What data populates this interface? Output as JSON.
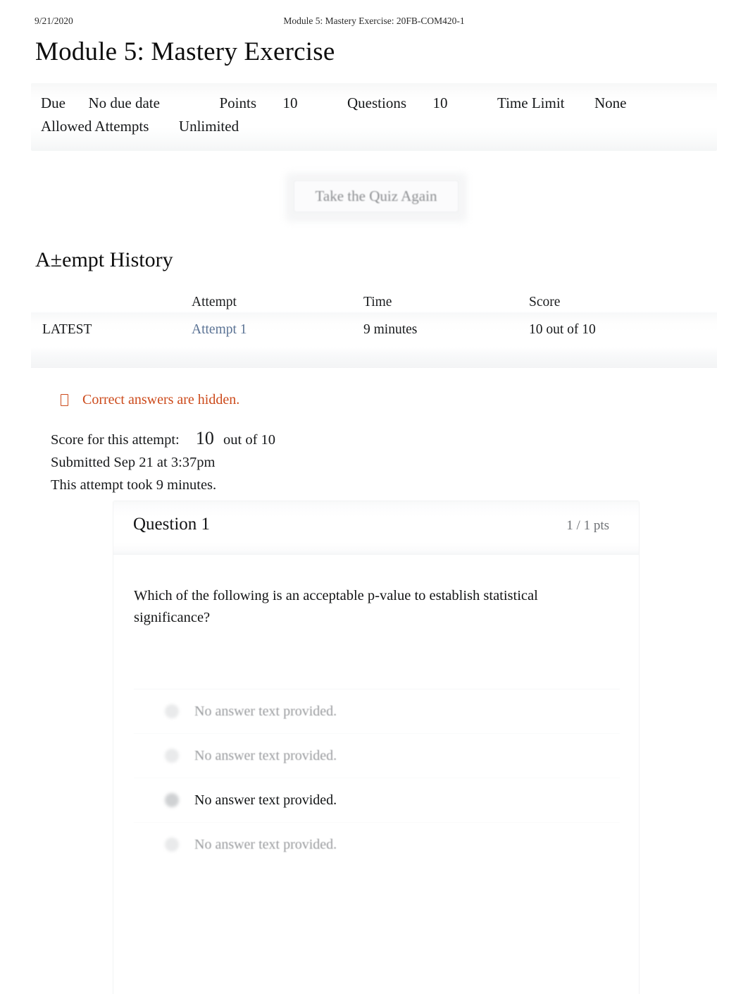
{
  "print_header": {
    "date": "9/21/2020",
    "title": "Module 5: Mastery Exercise: 20FB-COM420-1"
  },
  "page_title": "Module 5: Mastery Exercise",
  "quiz_meta": {
    "due_label": "Due",
    "due_value": "No due date",
    "points_label": "Points",
    "points_value": "10",
    "questions_label": "Questions",
    "questions_value": "10",
    "time_limit_label": "Time Limit",
    "time_limit_value": "None",
    "attempts_label": "Allowed Attempts",
    "attempts_value": "Unlimited"
  },
  "retake_button": {
    "label": "Take the Quiz Again"
  },
  "attempt_history": {
    "section_title": "A±empt History",
    "columns": [
      "",
      "Attempt",
      "Time",
      "Score"
    ],
    "rows": [
      {
        "flag": "LATEST",
        "attempt": "Attempt 1",
        "time": "9 minutes",
        "score": "10 out of 10"
      }
    ]
  },
  "notice": {
    "icon": "missing-glyph-box",
    "text": "Correct answers are hidden.",
    "color": "#cc4a1b"
  },
  "attempt_summary": {
    "score_label": "Score for this attempt:",
    "score_value": "10",
    "score_suffix": "out of 10",
    "submitted": "Submitted Sep 21 at 3:37pm",
    "duration": "This attempt took 9 minutes."
  },
  "question": {
    "title": "Question 1",
    "points": "1 / 1 pts",
    "text": "Which of the following is an acceptable p-value to establish statistical significance?",
    "answers": [
      {
        "text": "No answer text provided.",
        "selected": false
      },
      {
        "text": "No answer text provided.",
        "selected": false
      },
      {
        "text": "No answer text provided.",
        "selected": true
      },
      {
        "text": "No answer text provided.",
        "selected": false
      }
    ]
  },
  "colors": {
    "link": "#5a7294",
    "notice": "#cc4a1b",
    "muted_text": "#9a9c9f",
    "band": "#f5f6f7"
  }
}
